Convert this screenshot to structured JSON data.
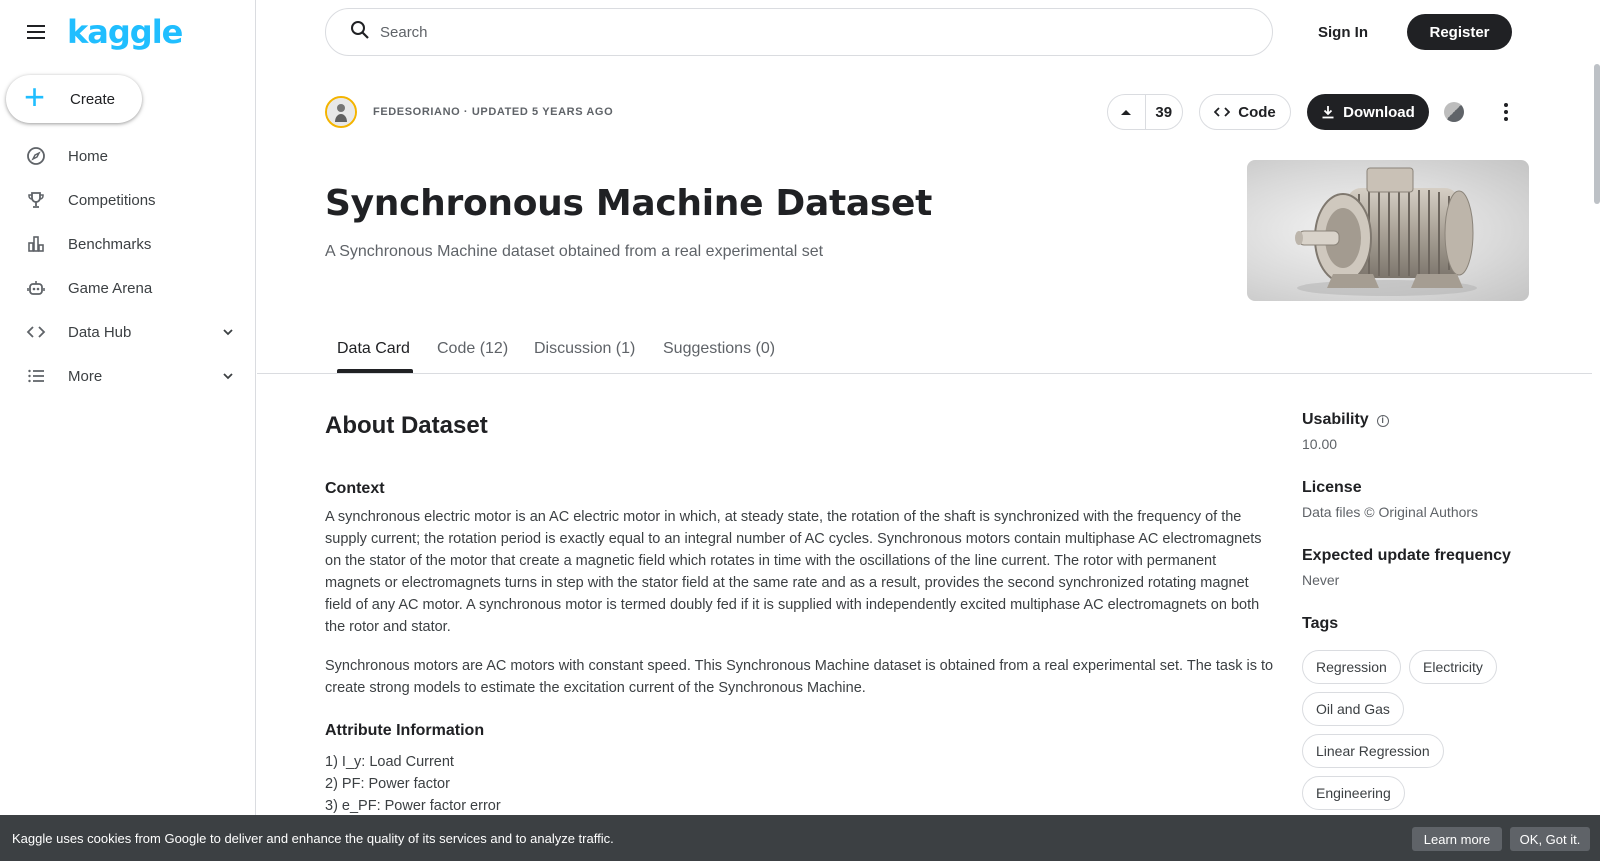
{
  "sidebar": {
    "logo": "kaggle",
    "create_label": "Create",
    "items": [
      {
        "label": "Home",
        "icon": "compass-icon"
      },
      {
        "label": "Competitions",
        "icon": "trophy-icon"
      },
      {
        "label": "Benchmarks",
        "icon": "bar-chart-icon"
      },
      {
        "label": "Game Arena",
        "icon": "robot-icon"
      },
      {
        "label": "Data Hub",
        "icon": "code-icon",
        "expandable": true
      },
      {
        "label": "More",
        "icon": "list-icon",
        "expandable": true
      }
    ]
  },
  "header": {
    "search_placeholder": "Search",
    "sign_in": "Sign In",
    "register": "Register"
  },
  "dataset": {
    "author_line": "FEDESORIANO · UPDATED 5 YEARS AGO",
    "upvotes": "39",
    "code_label": "Code",
    "download_label": "Download",
    "title": "Synchronous Machine Dataset",
    "subtitle": "A Synchronous Machine dataset obtained from a real experimental set"
  },
  "tabs": [
    {
      "label": "Data Card",
      "active": true
    },
    {
      "label": "Code (12)",
      "active": false
    },
    {
      "label": "Discussion (1)",
      "active": false
    },
    {
      "label": "Suggestions (0)",
      "active": false
    }
  ],
  "content": {
    "about_heading": "About Dataset",
    "context_heading": "Context",
    "context_para1": "A synchronous electric motor is an AC electric motor in which, at steady state, the rotation of the shaft is synchronized with the frequency of the supply current; the rotation period is exactly equal to an integral number of AC cycles. Synchronous motors contain multiphase AC electromagnets on the stator of the motor that create a magnetic field which rotates in time with the oscillations of the line current. The rotor with permanent magnets or electromagnets turns in step with the stator field at the same rate and as a result, provides the second synchronized rotating magnet field of any AC motor. A synchronous motor is termed doubly fed if it is supplied with independently excited multiphase AC electromagnets on both the rotor and stator.",
    "context_para2": "Synchronous motors are AC motors with constant speed. This Synchronous Machine dataset is obtained from a real experimental set. The task is to create strong models to estimate the excitation current of the Synchronous Machine.",
    "attr_heading": "Attribute Information",
    "attributes": [
      "1) I_y: Load Current",
      "2) PF: Power factor",
      "3) e_PF: Power factor error"
    ]
  },
  "meta": {
    "usability_label": "Usability",
    "usability_value": "10.00",
    "license_label": "License",
    "license_value": "Data files © Original Authors",
    "frequency_label": "Expected update frequency",
    "frequency_value": "Never",
    "tags_label": "Tags",
    "tags": [
      "Regression",
      "Electricity",
      "Oil and Gas",
      "Linear Regression",
      "Engineering"
    ]
  },
  "cookie": {
    "message": "Kaggle uses cookies from Google to deliver and enhance the quality of its services and to analyze traffic.",
    "learn_more": "Learn more",
    "ok": "OK, Got it."
  },
  "colors": {
    "brand": "#20beff",
    "dark": "#202124",
    "muted": "#5f6368",
    "border": "#dadce0"
  }
}
